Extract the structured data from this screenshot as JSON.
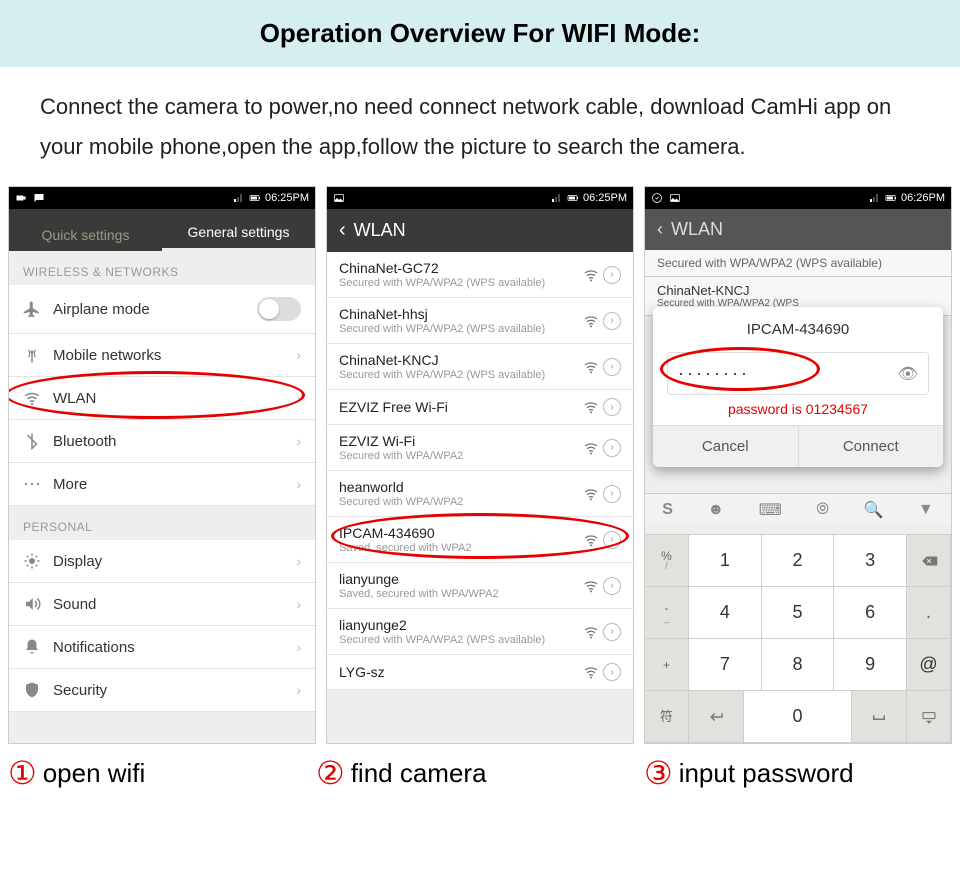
{
  "title": "Operation Overview For WIFI Mode:",
  "instructions": "Connect the camera to power,no need connect network cable, download CamHi app on your mobile phone,open the app,follow the picture to search the camera.",
  "phone1": {
    "time": "06:25PM",
    "tab1": "Quick settings",
    "tab2": "General settings",
    "section1": "WIRELESS & NETWORKS",
    "rows": {
      "airplane": "Airplane mode",
      "mobile": "Mobile networks",
      "wlan": "WLAN",
      "bluetooth": "Bluetooth",
      "more": "More"
    },
    "section2": "PERSONAL",
    "rows2": {
      "display": "Display",
      "sound": "Sound",
      "notifications": "Notifications",
      "security": "Security"
    }
  },
  "phone2": {
    "time": "06:25PM",
    "header": "WLAN",
    "networks": [
      {
        "name": "ChinaNet-GC72",
        "sub": "Secured with WPA/WPA2 (WPS available)"
      },
      {
        "name": "ChinaNet-hhsj",
        "sub": "Secured with WPA/WPA2 (WPS available)"
      },
      {
        "name": "ChinaNet-KNCJ",
        "sub": "Secured with WPA/WPA2 (WPS available)"
      },
      {
        "name": "EZVIZ Free Wi-Fi",
        "sub": ""
      },
      {
        "name": "EZVIZ Wi-Fi",
        "sub": "Secured with WPA/WPA2"
      },
      {
        "name": "heanworld",
        "sub": "Secured with WPA/WPA2"
      },
      {
        "name": "IPCAM-434690",
        "sub": "Saved, secured with WPA2"
      },
      {
        "name": "lianyunge",
        "sub": "Saved, secured with WPA/WPA2"
      },
      {
        "name": "lianyunge2",
        "sub": "Secured with WPA/WPA2 (WPS available)"
      },
      {
        "name": "LYG-sz",
        "sub": ""
      }
    ]
  },
  "phone3": {
    "time": "06:26PM",
    "header": "WLAN",
    "dim1": "Secured with WPA/WPA2 (WPS available)",
    "dim2": "ChinaNet-KNCJ",
    "dim2sub": "Secured with WPA/WPA2 (WPS",
    "dialog_title": "IPCAM-434690",
    "password_dots": "········",
    "password_hint": "password is 01234567",
    "cancel": "Cancel",
    "connect": "Connect",
    "keys": {
      "r1side": [
        "%",
        "/"
      ],
      "r1": [
        "1",
        "2",
        "3"
      ],
      "r2side": [
        "-",
        "_"
      ],
      "r2": [
        "4",
        "5",
        "6"
      ],
      "r3side": [
        "+",
        ""
      ],
      "r3": [
        "7",
        "8",
        "9"
      ],
      "r4side": "符",
      "space": "␣",
      "zero": "0",
      "at": "@"
    }
  },
  "captions": {
    "c1": {
      "num": "①",
      "text": "open wifi"
    },
    "c2": {
      "num": "②",
      "text": "find camera"
    },
    "c3": {
      "num": "③",
      "text": "input password"
    }
  }
}
